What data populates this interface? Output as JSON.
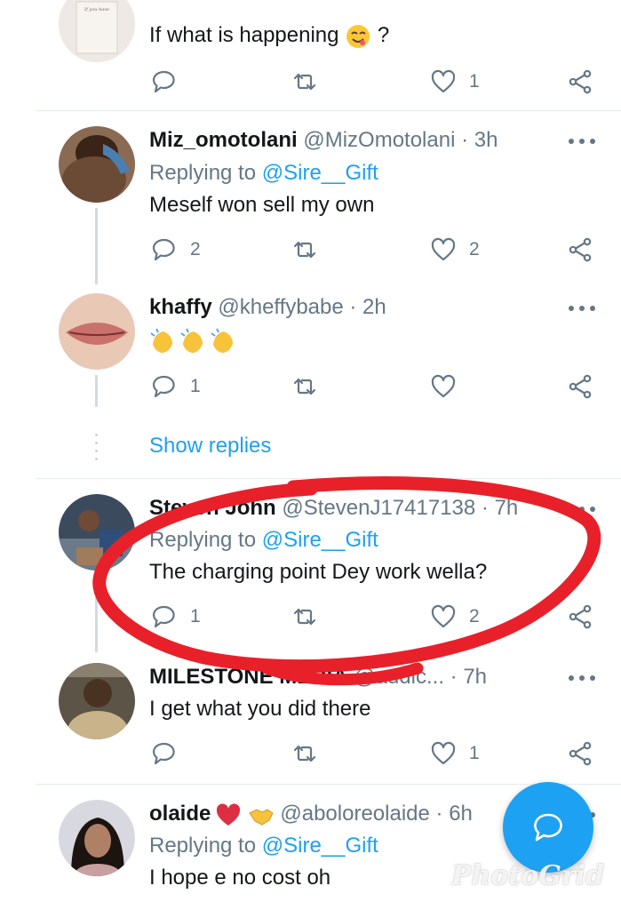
{
  "tweets": [
    {
      "name": "",
      "handle": "",
      "time": "",
      "replying_prefix": "",
      "replying_to": "",
      "text": "If what is happening",
      "text_suffix": "?",
      "counts": {
        "reply": "",
        "retweet": "",
        "like": "1"
      },
      "avatar_text": "If you have the power to make someone happy, do it. The world needs more of that."
    },
    {
      "name": "Miz_omotolani",
      "handle": "@MizOmotolani",
      "time": "· 3h",
      "replying_prefix": "Replying to ",
      "replying_to": "@Sire__Gift",
      "text": "Meself won sell my own",
      "counts": {
        "reply": "2",
        "retweet": "",
        "like": "2"
      }
    },
    {
      "name": "khaffy",
      "handle": "@kheffybabe",
      "time": "· 2h",
      "text": "",
      "counts": {
        "reply": "1",
        "retweet": "",
        "like": ""
      }
    },
    {
      "name": "Steven John",
      "handle": "@StevenJ17417138",
      "time": "· 7h",
      "replying_prefix": "Replying to ",
      "replying_to": "@Sire__Gift",
      "text": "The charging point Dey work wella?",
      "counts": {
        "reply": "1",
        "retweet": "",
        "like": "2"
      }
    },
    {
      "name": "MILESTONE MEDIA",
      "handle": "@audic...",
      "time": "· 7h",
      "text": "I get what you did there",
      "counts": {
        "reply": "",
        "retweet": "",
        "like": "1"
      }
    },
    {
      "name": "olaide",
      "handle": "@aboloreolaide",
      "time": "· 6h",
      "replying_prefix": "Replying to ",
      "replying_to": "@Sire__Gift",
      "text": "I hope e no cost oh"
    }
  ],
  "show_replies": "Show replies",
  "watermark": "PhotoGrid",
  "colors": {
    "accent": "#1da1f2",
    "secondary_text": "#657786",
    "annotation": "#e8202a"
  },
  "icons": [
    "reply-icon",
    "retweet-icon",
    "like-icon",
    "share-icon",
    "more-icon",
    "compose-icon"
  ]
}
